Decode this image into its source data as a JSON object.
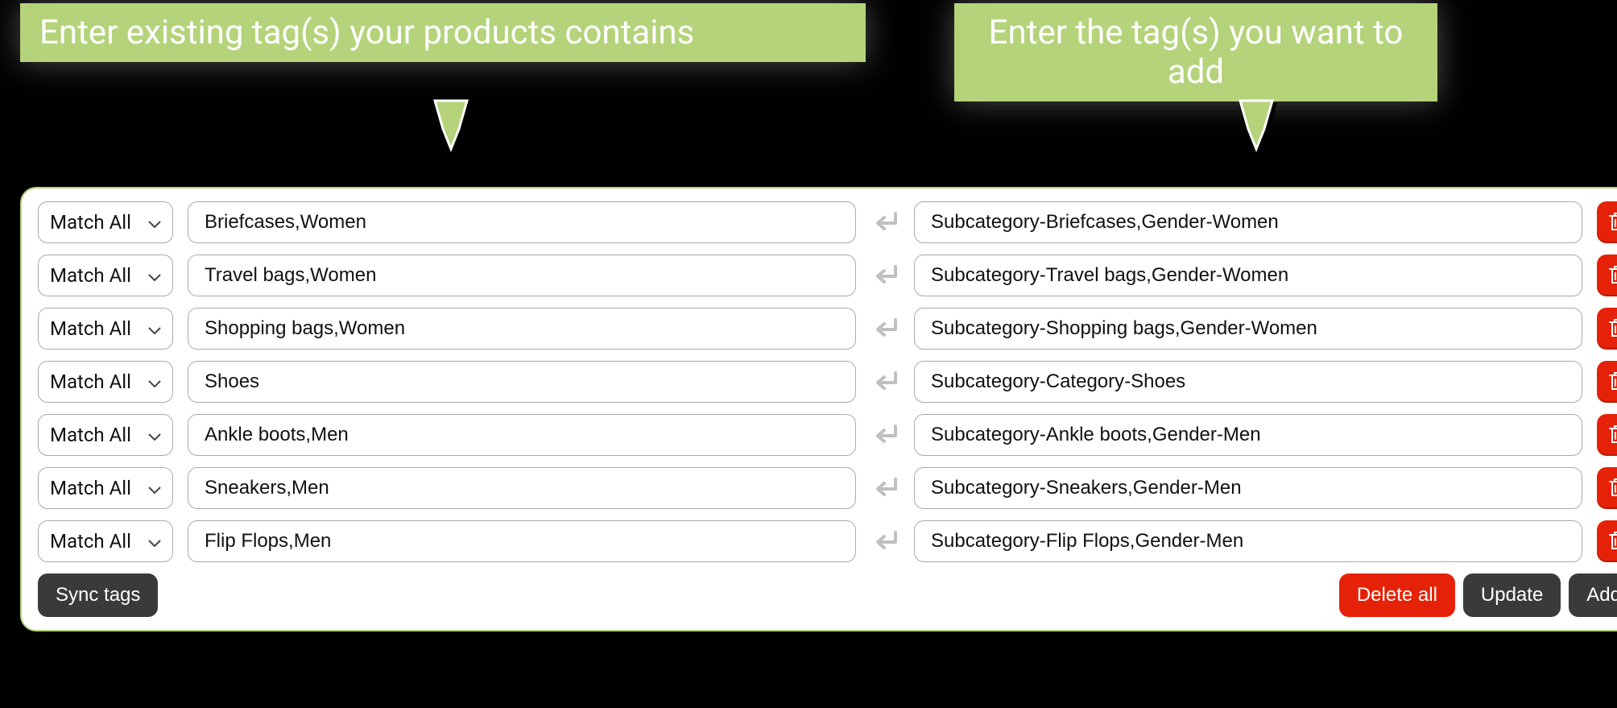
{
  "callouts": {
    "left": "Enter existing tag(s) your products contains",
    "right": "Enter the tag(s) you want to add"
  },
  "match_label": "Match All",
  "rows": [
    {
      "existing": "Briefcases,Women",
      "add": "Subcategory-Briefcases,Gender-Women"
    },
    {
      "existing": "Travel bags,Women",
      "add": "Subcategory-Travel bags,Gender-Women"
    },
    {
      "existing": "Shopping bags,Women",
      "add": "Subcategory-Shopping bags,Gender-Women"
    },
    {
      "existing": "Shoes",
      "add": "Subcategory-Category-Shoes"
    },
    {
      "existing": "Ankle boots,Men",
      "add": "Subcategory-Ankle boots,Gender-Men"
    },
    {
      "existing": "Sneakers,Men",
      "add": "Subcategory-Sneakers,Gender-Men"
    },
    {
      "existing": "Flip Flops,Men",
      "add": "Subcategory-Flip Flops,Gender-Men"
    }
  ],
  "buttons": {
    "sync": "Sync tags",
    "delete_all": "Delete all",
    "update": "Update",
    "add": "Add"
  },
  "colors": {
    "accent_green": "#b4d37a",
    "danger_red": "#e52207",
    "dark_gray": "#3a3a3a"
  }
}
